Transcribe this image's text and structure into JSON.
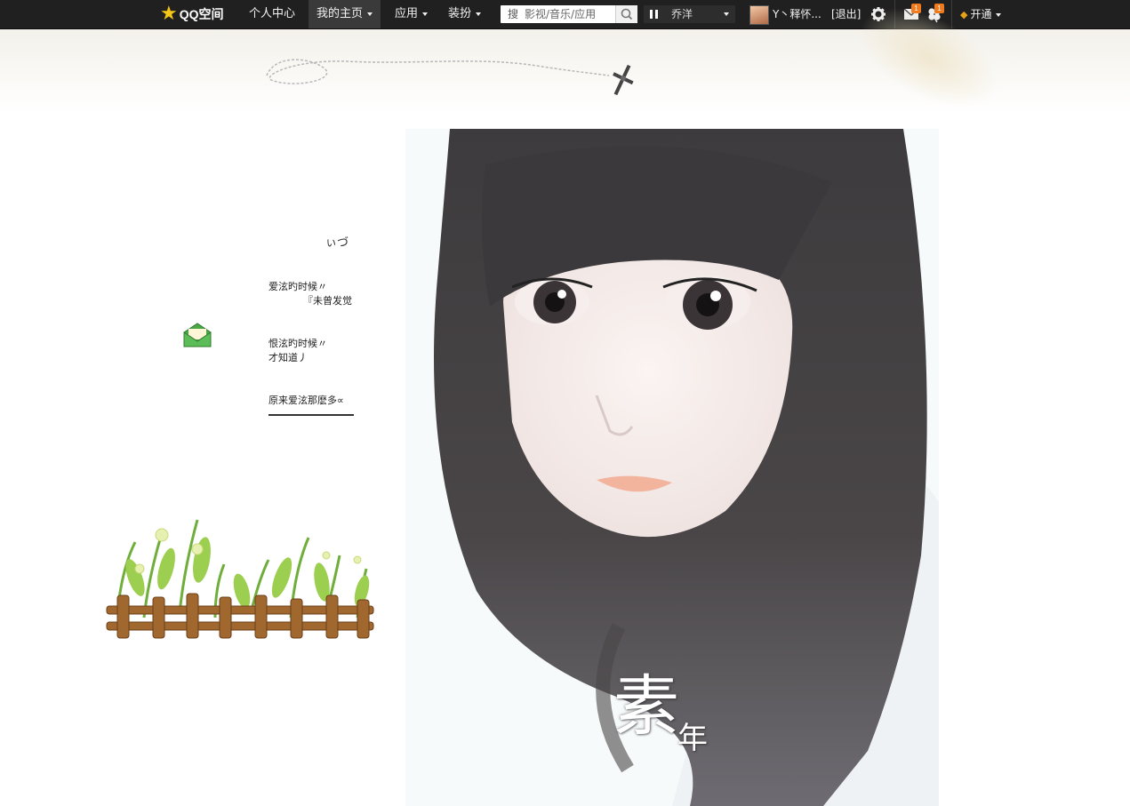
{
  "topbar": {
    "logo_text": "QQ空间",
    "nav": [
      "个人中心",
      "我的主页",
      "应用",
      "装扮"
    ],
    "search": {
      "prefix": "搜",
      "placeholder": "影视/音乐/应用"
    },
    "music": {
      "song": "乔洋"
    },
    "user": {
      "name": "Y丶释怀...",
      "logout": "[退出]"
    },
    "notifications": {
      "mail_count": "1",
      "updates_count": "1"
    },
    "vip_label": "开通"
  },
  "sidebar": {
    "signature": "ぃづ",
    "poem": [
      "爱泫旳时候〃",
      "『未曾发觉",
      "恨泫旳时候〃",
      "才知道丿",
      "原来爱泫那麽多∝"
    ]
  },
  "photo": {
    "caption_large": "素",
    "caption_small": "年"
  },
  "colors": {
    "topbar_bg": "#202020",
    "badge": "#f07a1c",
    "vip_gem": "#e5a317"
  },
  "icons": [
    "star-logo-icon",
    "caret-down-icon",
    "search-icon",
    "pause-icon",
    "gear-icon",
    "mail-icon",
    "clover-icon",
    "diamond-icon",
    "envelope-icon"
  ]
}
